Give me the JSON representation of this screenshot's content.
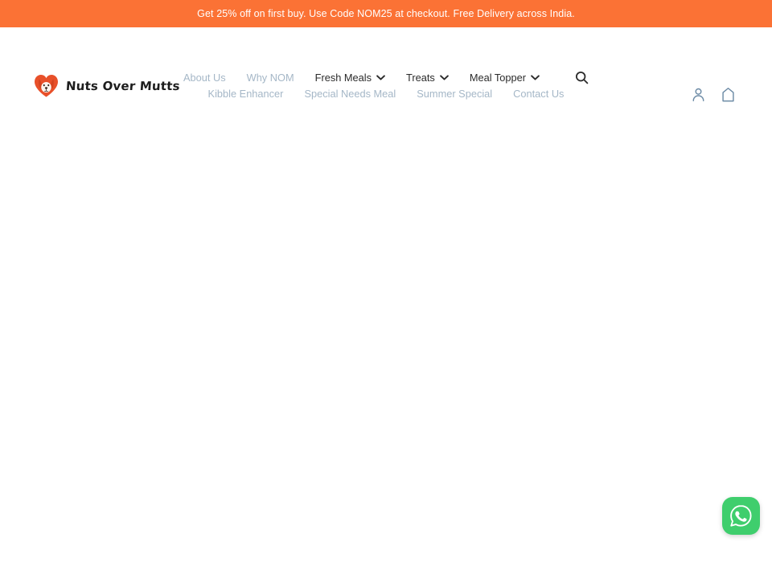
{
  "promo": {
    "text": "Get 25% off on first buy. Use Code NOM25 at checkout. Free Delivery across India.",
    "background_color": "#fb7235",
    "text_color": "#ffffff"
  },
  "header": {
    "logo": {
      "icon": "heart-dog-face-icon",
      "text": "Nuts Over Mutts",
      "mark_color": "#e8502a"
    },
    "nav": {
      "row_primary": [
        {
          "label": "About Us",
          "has_dropdown": false
        },
        {
          "label": "Why NOM",
          "has_dropdown": false
        },
        {
          "label": "Fresh Meals",
          "has_dropdown": true
        },
        {
          "label": "Treats",
          "has_dropdown": true
        },
        {
          "label": "Meal Topper",
          "has_dropdown": true
        }
      ],
      "row_secondary": [
        {
          "label": "Kibble Enhancer",
          "has_dropdown": false
        },
        {
          "label": "Special Needs Meal",
          "has_dropdown": false
        },
        {
          "label": "Summer Special",
          "has_dropdown": false
        },
        {
          "label": "Contact Us",
          "has_dropdown": false
        }
      ],
      "link_color": "#a5b7c7",
      "dropdown_link_color": "#2b2b2b"
    },
    "search": {
      "icon": "search-icon"
    },
    "actions": [
      {
        "icon": "account-icon",
        "name": "account"
      },
      {
        "icon": "cart-bag-icon",
        "name": "cart"
      }
    ],
    "action_icon_color": "#6b8aa5"
  },
  "floating": {
    "whatsapp": {
      "icon": "whatsapp-icon",
      "background_color": "#3fce6d"
    }
  }
}
